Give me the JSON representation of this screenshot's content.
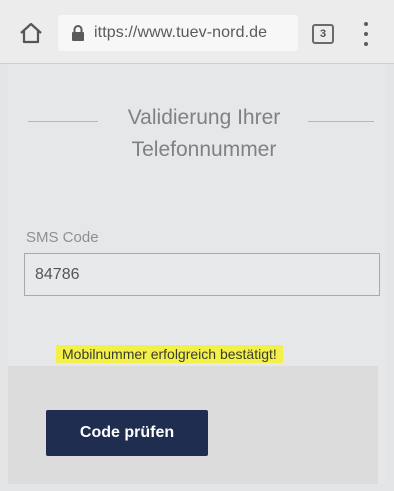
{
  "browser": {
    "url": "ittps://www.tuev-nord.de",
    "tab_count": "3",
    "icons": {
      "home": "home-icon",
      "lock": "lock-icon",
      "tabs": "tab-switcher-icon",
      "menu": "overflow-menu-icon"
    }
  },
  "page": {
    "title_line1": "Validierung Ihrer",
    "title_line2": "Telefonnummer",
    "sms_label": "SMS Code",
    "sms_value": "84786",
    "success_message": "Mobilnummer erfolgreich bestätigt!",
    "submit_label": "Code prüfen"
  },
  "colors": {
    "button_bg": "#1f2d50",
    "highlight": "#f3f04a",
    "title_text": "#7e8287"
  }
}
